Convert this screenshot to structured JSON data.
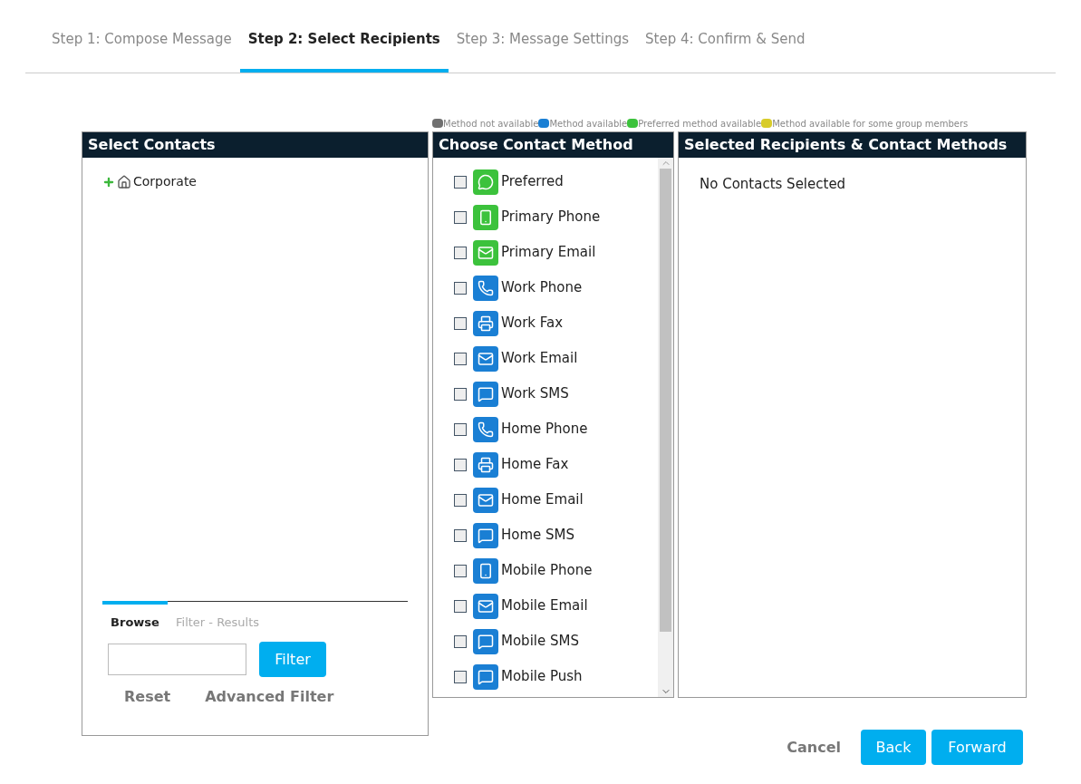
{
  "steps": [
    {
      "label": "Step 1: Compose Message",
      "selected": false
    },
    {
      "label": "Step 2: Select Recipients",
      "selected": true
    },
    {
      "label": "Step 3: Message Settings",
      "selected": false
    },
    {
      "label": "Step 4: Confirm & Send",
      "selected": false
    }
  ],
  "legend": [
    {
      "label": "Method not available",
      "color": "#707070"
    },
    {
      "label": "Method available",
      "color": "#1a7fd4"
    },
    {
      "label": "Preferred method available",
      "color": "#3cc23c"
    },
    {
      "label": "Method available for some group members",
      "color": "#d8cc2a"
    }
  ],
  "contacts_panel": {
    "title": "Select Contacts",
    "tree": [
      {
        "label": "Corporate",
        "expanded": false
      }
    ],
    "tabs": [
      {
        "label": "Browse",
        "selected": true
      },
      {
        "label": "Filter - Results",
        "selected": false
      }
    ],
    "filter_button": "Filter",
    "reset_link": "Reset",
    "advanced_link": "Advanced Filter"
  },
  "methods_panel": {
    "title": "Choose Contact Method",
    "methods": [
      {
        "label": "Preferred",
        "kind": "chat",
        "checked": false,
        "color": "#3cc23c"
      },
      {
        "label": "Primary Phone",
        "kind": "mobile",
        "checked": false,
        "color": "#3cc23c"
      },
      {
        "label": "Primary Email",
        "kind": "mail",
        "checked": false,
        "color": "#3cc23c"
      },
      {
        "label": "Work Phone",
        "kind": "phone",
        "checked": false,
        "color": "#1a7fd4"
      },
      {
        "label": "Work Fax",
        "kind": "fax",
        "checked": false,
        "color": "#1a7fd4"
      },
      {
        "label": "Work Email",
        "kind": "mail",
        "checked": false,
        "color": "#1a7fd4"
      },
      {
        "label": "Work SMS",
        "kind": "sms",
        "checked": false,
        "color": "#1a7fd4"
      },
      {
        "label": "Home Phone",
        "kind": "phone",
        "checked": false,
        "color": "#1a7fd4"
      },
      {
        "label": "Home Fax",
        "kind": "fax",
        "checked": false,
        "color": "#1a7fd4"
      },
      {
        "label": "Home Email",
        "kind": "mail",
        "checked": false,
        "color": "#1a7fd4"
      },
      {
        "label": "Home SMS",
        "kind": "sms",
        "checked": false,
        "color": "#1a7fd4"
      },
      {
        "label": "Mobile Phone",
        "kind": "mobile",
        "checked": false,
        "color": "#1a7fd4"
      },
      {
        "label": "Mobile Email",
        "kind": "mail",
        "checked": false,
        "color": "#1a7fd4"
      },
      {
        "label": "Mobile SMS",
        "kind": "sms",
        "checked": false,
        "color": "#1a7fd4"
      },
      {
        "label": "Mobile Push",
        "kind": "sms",
        "checked": false,
        "color": "#1a7fd4"
      }
    ]
  },
  "recipients_panel": {
    "title": "Selected Recipients & Contact Methods",
    "empty_text": "No Contacts Selected"
  },
  "buttons": {
    "cancel": "Cancel",
    "back": "Back",
    "forward": "Forward"
  }
}
